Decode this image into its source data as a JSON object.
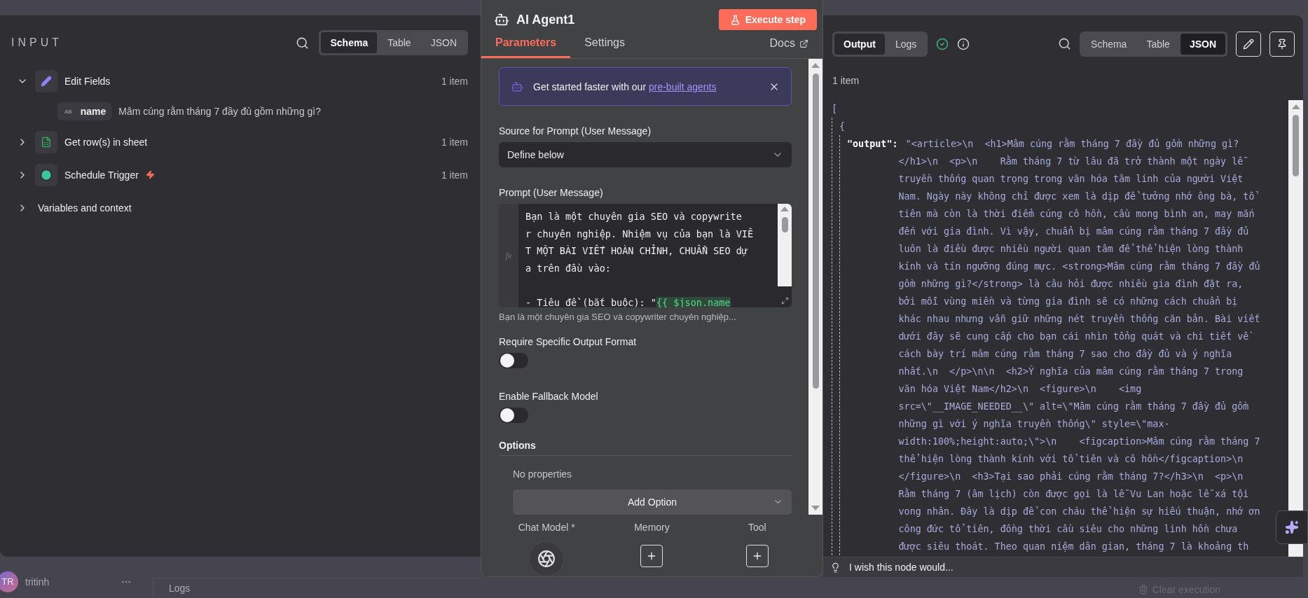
{
  "input_panel": {
    "title": "INPUT",
    "views": [
      {
        "label": "Schema",
        "selected": true
      },
      {
        "label": "Table",
        "selected": false
      },
      {
        "label": "JSON",
        "selected": false
      }
    ],
    "nodes": [
      {
        "kind": "edit",
        "name": "Edit Fields",
        "count": "1 item",
        "expanded": true,
        "fields": [
          {
            "type": "AB",
            "name": "name",
            "value": "Mâm cúng rằm tháng 7 đầy đủ gồm những gì?"
          }
        ]
      },
      {
        "kind": "sheet",
        "name": "Get row(s) in sheet",
        "count": "1 item",
        "expanded": false
      },
      {
        "kind": "trigger",
        "name": "Schedule Trigger",
        "count": "1 item",
        "expanded": false
      }
    ],
    "variables": {
      "label": "Variables and context",
      "expanded": false
    }
  },
  "node": {
    "title": "AI Agent1",
    "execute": "Execute step",
    "tabs": [
      {
        "label": "Parameters",
        "selected": true
      },
      {
        "label": "Settings",
        "selected": false
      }
    ],
    "docs": "Docs",
    "callout": {
      "text": "Get started faster with our ",
      "link": "pre-built agents"
    },
    "source": {
      "label": "Source for Prompt (User Message)",
      "value": "Define below"
    },
    "prompt": {
      "label": "Prompt (User Message)",
      "gutter": "fx",
      "paragraphs": [
        [
          {
            "text": "Bạn là một chuyên gia SEO và copywrite"
          },
          {
            "text": "r chuyên nghiệp. Nhiệm vụ của bạn là VIÊ"
          },
          {
            "text": "T MỘT BÀI VIẾT HOÀN CHỈNH, CHUẨN SEO dự"
          },
          {
            "text": "a trên đầu vào:"
          }
        ],
        [
          {
            "text": "- Tiêu đề`(bắt buộc): \"",
            "expression": "{{ $json.name"
          }
        ]
      ],
      "hint": "Bạn là một chuyên gia SEO và copywriter chuyên nghiệp..."
    },
    "toggles": [
      {
        "label": "Require Specific Output Format",
        "on": false
      },
      {
        "label": "Enable Fallback Model",
        "on": false
      }
    ],
    "options": {
      "title": "Options",
      "empty": "No properties",
      "add": "Add Option"
    },
    "connectors": [
      {
        "label": "Chat Model *",
        "kind": "model"
      },
      {
        "label": "Memory",
        "kind": "add"
      },
      {
        "label": "Tool",
        "kind": "add"
      }
    ]
  },
  "output_panel": {
    "modes": [
      {
        "label": "Output",
        "selected": true
      },
      {
        "label": "Logs",
        "selected": false
      }
    ],
    "success": true,
    "views": [
      {
        "label": "Schema",
        "selected": false
      },
      {
        "label": "Table",
        "selected": false
      },
      {
        "label": "JSON",
        "selected": true
      }
    ],
    "count": "1 item",
    "json": {
      "open_bracket": "[",
      "open_brace": "{",
      "key": "\"output\":",
      "value_lines": [
        "\"<article>\\n  <h1>Mâm cúng rằm tháng 7 đầy đủ gồm những gì?",
        "</h1>\\n  <p>\\n    Rằm tháng 7 từ lâu đã trở thành một ngày lễ",
        "truyền thống quan trọng trong văn hóa tâm linh của người Việt",
        "Nam. Ngày này không chỉ được xem là dịp để tưởng nhớ ông bà, tổ",
        "tiên mà còn là thời điểm cúng cô hồn, cầu mong bình an, may mắn",
        "đến với gia đình. Vì vậy, chuẩn bị mâm cúng rằm tháng 7 đầy đủ",
        "luôn là điều được nhiều người quan tâm để thể hiện lòng thành",
        "kính và tín ngưỡng đúng mực. <strong>Mâm cúng rằm tháng 7 đầy đủ",
        "gồm những gì?</strong> là câu hỏi được nhiều gia đình đặt ra,",
        "bởi mỗi vùng miền và từng gia đình sẽ có những cách chuẩn bị",
        "khác nhau nhưng vẫn giữ những nét truyền thống căn bản. Bài viết",
        "dưới đây sẽ cung cấp cho bạn cái nhìn tổng quát và chi tiết về",
        "cách bày trí mâm cúng rằm tháng 7 sao cho đầy đủ và ý nghĩa",
        "nhất.\\n  </p>\\n\\n  <h2>Ý nghĩa của mâm cúng rằm tháng 7 trong",
        "văn hóa Việt Nam</h2>\\n  <figure>\\n    <img",
        "src=\\\"__IMAGE_NEEDED__\\\" alt=\\\"Mâm cúng rằm tháng 7 đầy đủ gồm",
        "những gì với ý nghĩa truyền thống\\\" style=\\\"max-",
        "width:100%;height:auto;\\\">\\n    <figcaption>Mâm cúng rằm tháng 7",
        "thể hiện lòng thành kính với tổ tiên và cô hồn</figcaption>\\n",
        "</figure>\\n  <h3>Tại sao phải cúng rằm tháng 7?</h3>\\n  <p>\\n",
        "Rằm tháng 7 (âm lịch) còn được gọi là lễ Vu Lan hoặc lễ xá tội",
        "vong nhân. Đây là dịp để con cháu thể hiện sự hiếu thuận, nhớ ơn",
        "công đức tổ tiên, đồng thời cầu siêu cho những linh hồn chưa",
        "được siêu thoát. Theo quan niệm dân gian, tháng 7 là khoảng th"
      ]
    },
    "feedback": "I wish this node would..."
  },
  "user": {
    "initials": "TR",
    "name": "tritinh"
  },
  "logs_bar": {
    "title": "Logs",
    "clear": "Clear execution"
  }
}
